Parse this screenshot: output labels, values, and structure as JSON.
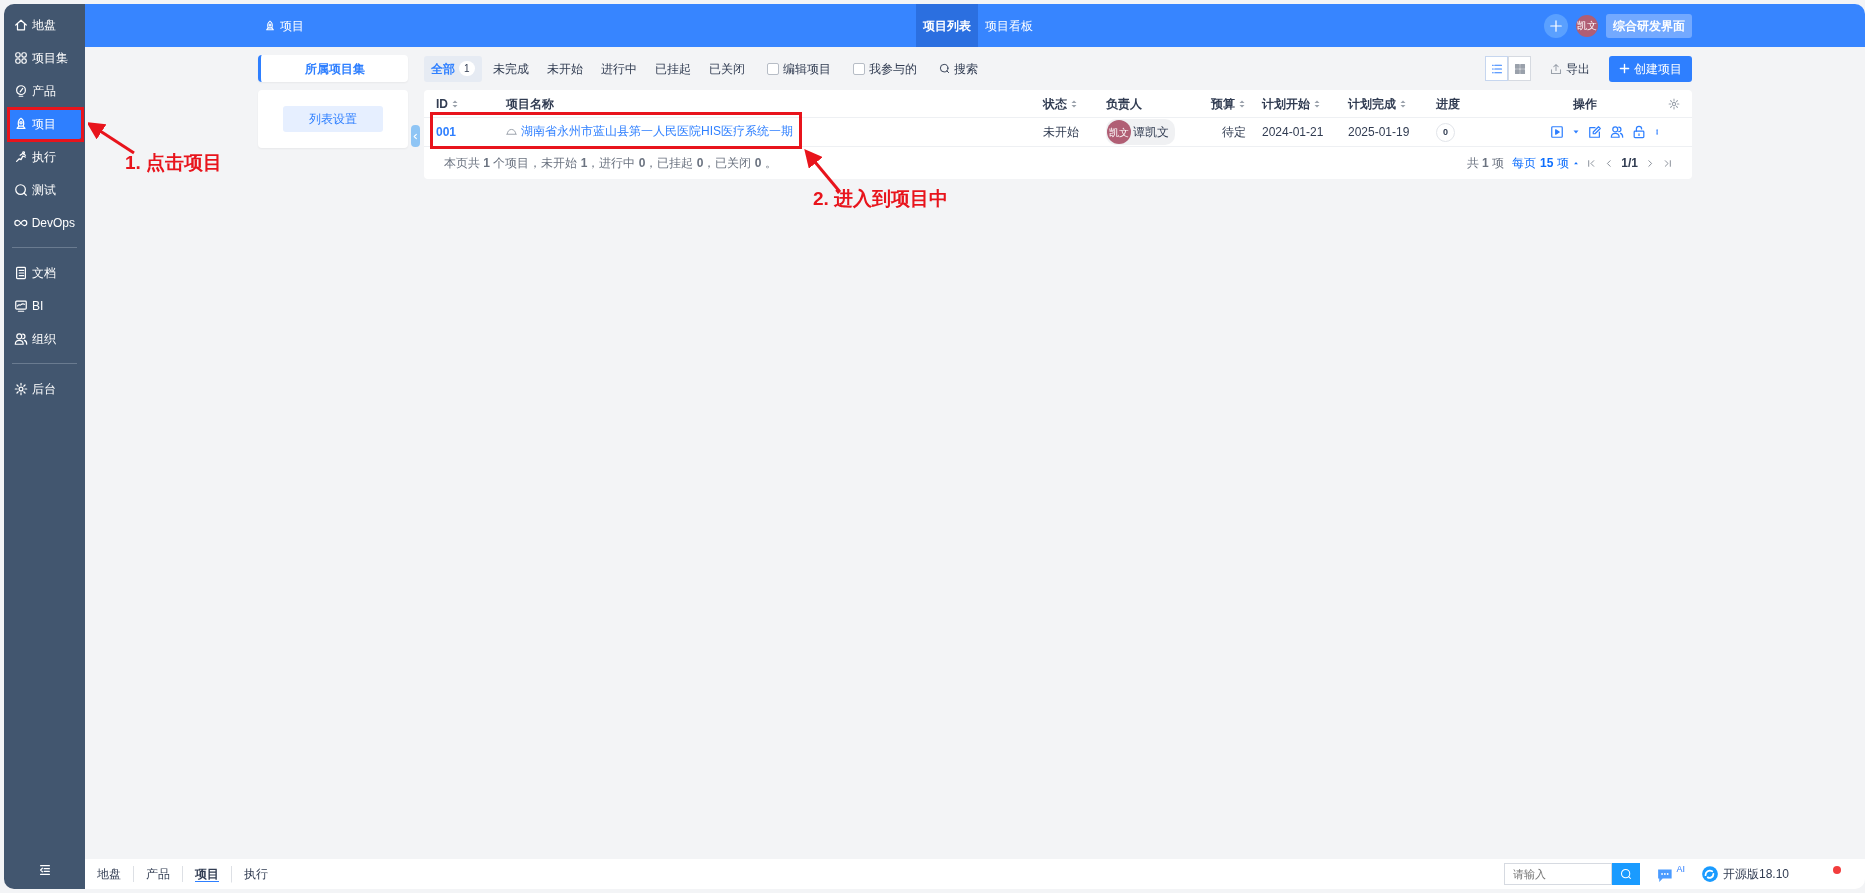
{
  "sidebar": {
    "groups": [
      {
        "items": [
          {
            "label": "地盘",
            "selected": false
          },
          {
            "label": "项目集",
            "selected": false
          },
          {
            "label": "产品",
            "selected": false
          },
          {
            "label": "项目",
            "selected": true
          },
          {
            "label": "执行",
            "selected": false
          },
          {
            "label": "测试",
            "selected": false
          },
          {
            "label": "DevOps",
            "selected": false
          }
        ]
      },
      {
        "items": [
          {
            "label": "文档",
            "selected": false
          },
          {
            "label": "BI",
            "selected": false
          },
          {
            "label": "组织",
            "selected": false
          }
        ]
      },
      {
        "items": [
          {
            "label": "后台",
            "selected": false
          }
        ]
      }
    ]
  },
  "header": {
    "title": "项目",
    "tabs": [
      {
        "label": "项目列表",
        "selected": true
      },
      {
        "label": "项目看板",
        "selected": false
      }
    ],
    "avatar": "凯文",
    "switch_button": "综合研发界面"
  },
  "side_panel": {
    "tab": "所属项目集",
    "button": "列表设置"
  },
  "filters": {
    "tabs": [
      {
        "label": "全部",
        "count": "1",
        "selected": true
      },
      {
        "label": "未完成",
        "selected": false
      },
      {
        "label": "未开始",
        "selected": false
      },
      {
        "label": "进行中",
        "selected": false
      },
      {
        "label": "已挂起",
        "selected": false
      },
      {
        "label": "已关闭",
        "selected": false
      }
    ],
    "checkboxes": [
      {
        "label": "编辑项目",
        "checked": false
      },
      {
        "label": "我参与的",
        "checked": false
      }
    ],
    "search": "搜索",
    "view_modes": [
      {
        "selected": true
      },
      {
        "selected": false
      }
    ],
    "export": "导出",
    "create": "创建项目"
  },
  "table": {
    "columns": [
      {
        "label": "ID",
        "sortable": true
      },
      {
        "label": "项目名称",
        "sortable": false
      },
      {
        "label": "状态",
        "sortable": true
      },
      {
        "label": "负责人",
        "sortable": false
      },
      {
        "label": "预算",
        "sortable": true
      },
      {
        "label": "计划开始",
        "sortable": true
      },
      {
        "label": "计划完成",
        "sortable": true
      },
      {
        "label": "进度",
        "sortable": false
      },
      {
        "label": "操作",
        "sortable": false
      }
    ],
    "rows": [
      {
        "id": "001",
        "name": "湖南省永州市蓝山县第一人民医院HIS医疗系统一期",
        "status": "未开始",
        "owner_avatar": "凯文",
        "owner": "谭凯文",
        "budget": "待定",
        "start": "2024-01-21",
        "end": "2025-01-19",
        "progress": "0"
      }
    ],
    "summary": "本页共 **1** 个项目，未开始 **1**，进行中 **0**，已挂起 **0**，已关闭 **0** 。",
    "pager": {
      "total": "共 **1** 项",
      "per_page": "每页 **15** 项",
      "page": "1/1"
    }
  },
  "bottom_bar": {
    "tabs": [
      {
        "label": "地盘",
        "selected": false
      },
      {
        "label": "产品",
        "selected": false
      },
      {
        "label": "项目",
        "selected": true
      },
      {
        "label": "执行",
        "selected": false
      }
    ],
    "search": {
      "placeholder": "请输入"
    },
    "ai_badge": "AI",
    "version": "开源版18.10"
  },
  "annotations": [
    {
      "text": "1. 点击项目"
    },
    {
      "text": "2. 进入到项目中"
    }
  ]
}
